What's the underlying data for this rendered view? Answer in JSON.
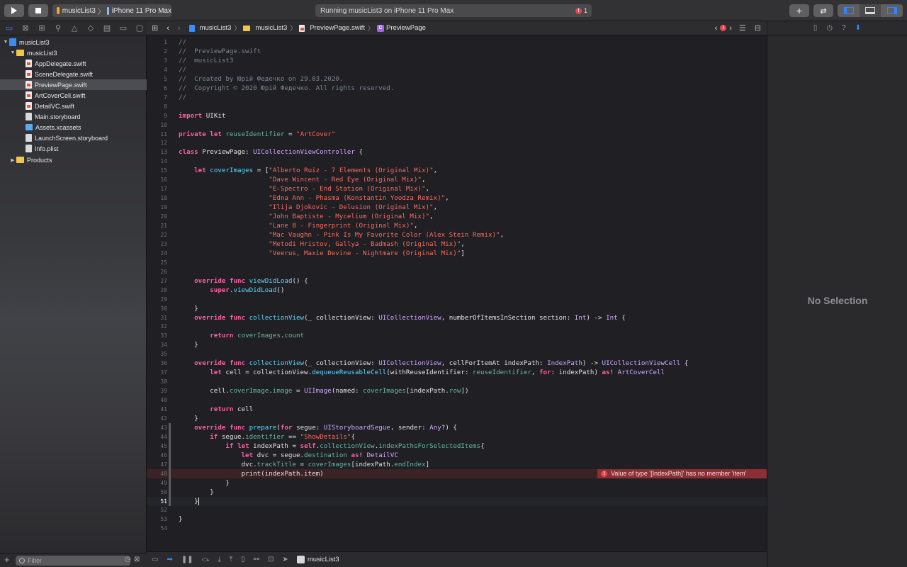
{
  "toolbar": {
    "scheme_target": "musicList3",
    "scheme_device": "iPhone 11 Pro Max",
    "activity_status": "Running musicList3 on iPhone 11 Pro Max",
    "activity_error_count": "1"
  },
  "navigator": {
    "project": "musicList3",
    "group": "musicList3",
    "files": [
      {
        "name": "AppDelegate.swift",
        "kind": "swift"
      },
      {
        "name": "SceneDelegate.swift",
        "kind": "swift"
      },
      {
        "name": "PreviewPage.swift",
        "kind": "swift",
        "selected": true
      },
      {
        "name": "ArtCoverCell.swift",
        "kind": "swift"
      },
      {
        "name": "DetailVC.swift",
        "kind": "swift"
      },
      {
        "name": "Main.storyboard",
        "kind": "storyboard"
      },
      {
        "name": "Assets.xcassets",
        "kind": "assets"
      },
      {
        "name": "LaunchScreen.storyboard",
        "kind": "storyboard"
      },
      {
        "name": "Info.plist",
        "kind": "plist"
      }
    ],
    "products": "Products",
    "filter_placeholder": "Filter"
  },
  "jumpbar": {
    "crumbs": [
      "musicList3",
      "musicList3",
      "PreviewPage.swift",
      "PreviewPage"
    ]
  },
  "editor": {
    "current_line": 51,
    "error_line": 48,
    "error_message": "Value of type '[IndexPath]' has no member 'item'",
    "lines": [
      "//",
      "//  PreviewPage.swift",
      "//  musicList3",
      "//",
      "//  Created by Юрій Федечко on 29.03.2020.",
      "//  Copyright © 2020 Юрій Федечко. All rights reserved.",
      "//",
      "",
      "import UIKit",
      "",
      "private let reuseIdentifier = \"ArtCover\"",
      "",
      "class PreviewPage: UICollectionViewController {",
      "",
      "    let coverImages = [\"Alberto Ruiz - 7 Elements (Original Mix)\",",
      "                       \"Dave Wincent - Red Eye (Original Mix)\",",
      "                       \"E-Spectro - End Station (Original Mix)\",",
      "                       \"Edna Ann - Phasma (Konstantin Yoodza Remix)\",",
      "                       \"Ilija Djokovic - Delusion (Original Mix)\",",
      "                       \"John Baptiste - Mycelium (Original Mix)\",",
      "                       \"Lane 8 - Fingerprint (Original Mix)\",",
      "                       \"Mac Vaughn - Pink Is My Favorite Color (Alex Stein Remix)\",",
      "                       \"Metodi Hristov, Gallya - Badmash (Original Mix)\",",
      "                       \"Veerus, Maxie Devine - Nightmare (Original Mix)\"]",
      "",
      "",
      "    override func viewDidLoad() {",
      "        super.viewDidLoad()",
      "",
      "    }",
      "    override func collectionView(_ collectionView: UICollectionView, numberOfItemsInSection section: Int) -> Int {",
      "",
      "        return coverImages.count",
      "    }",
      "",
      "    override func collectionView(_ collectionView: UICollectionView, cellForItemAt indexPath: IndexPath) -> UICollectionViewCell {",
      "        let cell = collectionView.dequeueReusableCell(withReuseIdentifier: reuseIdentifier, for: indexPath) as! ArtCoverCell",
      "",
      "        cell.coverImage.image = UIImage(named: coverImages[indexPath.row])",
      "",
      "        return cell",
      "    }",
      "    override func prepare(for segue: UIStoryboardSegue, sender: Any?) {",
      "        if segue.identifier == \"ShowDetails\"{",
      "            if let indexPath = self.collectionView.indexPathsForSelectedItems{",
      "                let dvc = segue.destination as! DetailVC",
      "                dvc.trackTitle = coverImages[indexPath.endIndex]",
      "                print(indexPath.item)",
      "            }",
      "        }",
      "    }",
      "",
      "}",
      ""
    ]
  },
  "debugbar": {
    "target": "musicList3"
  },
  "inspector": {
    "empty_label": "No Selection"
  }
}
